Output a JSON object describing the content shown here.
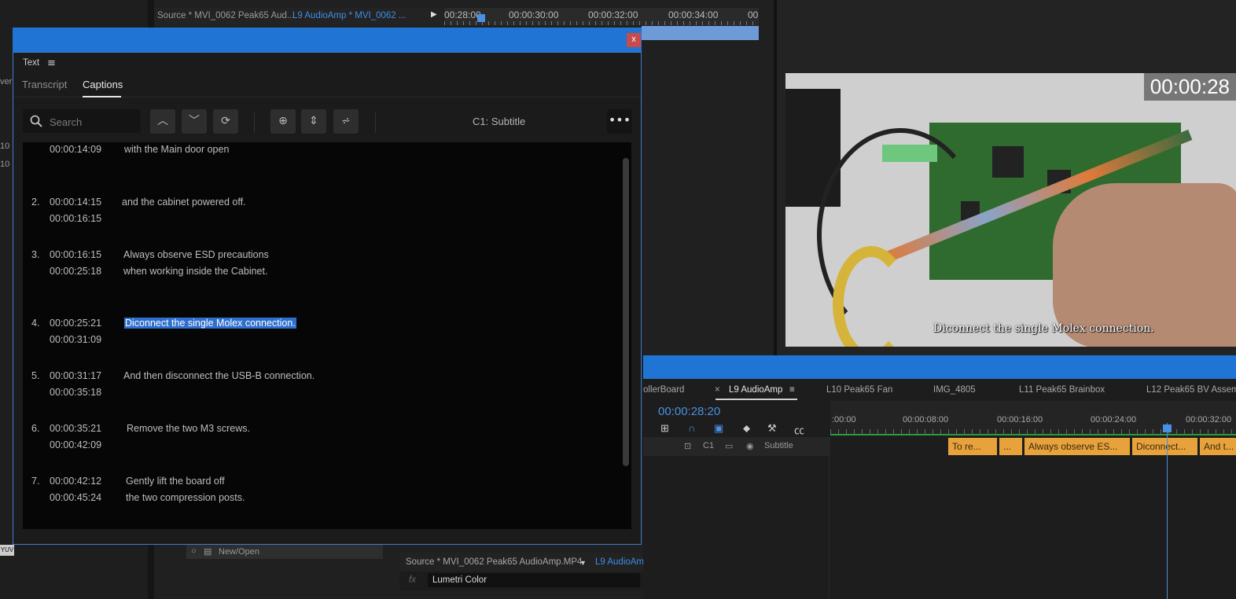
{
  "source_tabs": {
    "tab1": "Source * MVI_0062 Peak65 Aud...",
    "tab2": "L9 AudioAmp * MVI_0062 ..."
  },
  "mini_ruler": {
    "t0": "00:28:00",
    "t1": "00:00:30:00",
    "t2": "00:00:32:00",
    "t3": "00:00:34:00",
    "t4": "00"
  },
  "left_fragments": {
    "a": "ver",
    "b": "10",
    "c": "10",
    "d": "YUV"
  },
  "text_panel": {
    "close": "x",
    "panel_title": "Text",
    "menu_glyph": "≡",
    "tabs": {
      "transcript": "Transcript",
      "captions": "Captions"
    },
    "search": {
      "placeholder": "Search",
      "value": ""
    },
    "track_label": "C1: Subtitle",
    "more": "•••",
    "captions": [
      {
        "num": "",
        "in": "00:00:14:09",
        "out": "",
        "line1": "with the Main door open",
        "line2": ""
      },
      {
        "num": "2.",
        "in": "00:00:14:15",
        "out": "00:00:16:15",
        "line1": "and the cabinet powered off.",
        "line2": ""
      },
      {
        "num": "3.",
        "in": "00:00:16:15",
        "out": "00:00:25:18",
        "line1": "Always observe ESD precautions",
        "line2": "when working inside the Cabinet."
      },
      {
        "num": "4.",
        "in": "00:00:25:21",
        "out": "00:00:31:09",
        "line1": "Diconnect the single Molex connection.",
        "line2": ""
      },
      {
        "num": "5.",
        "in": "00:00:31:17",
        "out": "00:00:35:18",
        "line1": "And then disconnect the USB-B connection.",
        "line2": ""
      },
      {
        "num": "6.",
        "in": "00:00:35:21",
        "out": "00:00:42:09",
        "line1": "Remove the two M3 screws.",
        "line2": ""
      },
      {
        "num": "7.",
        "in": "00:00:42:12",
        "out": "00:00:45:24",
        "line1": "Gently lift the board off",
        "line2": "the two compression posts."
      }
    ]
  },
  "preview": {
    "timecode": "00:00:28",
    "caption": "Diconnect the single Molex connection."
  },
  "timeline": {
    "tabs": [
      "ollerBoard",
      "×",
      "L9 AudioAmp",
      "≡",
      "L10 Peak65 Fan",
      "IMG_4805",
      "L11 Peak65 Brainbox",
      "L12 Peak65 BV Assem"
    ],
    "timecode": "00:00:28:20",
    "ruler": [
      ":00:00",
      "00:00:08:00",
      "00:00:16:00",
      "00:00:24:00",
      "00:00:32:00"
    ],
    "track": {
      "lock": "🔒",
      "name": "C1",
      "label": "Subtitle"
    },
    "clips": [
      "To re...",
      "...",
      "Always observe ES...",
      "Diconnect...",
      "And t..."
    ]
  },
  "bottom": {
    "source": "Source * MVI_0062 Peak65 AudioAmp.MP4",
    "seq": "L9 AudioAm",
    "fx": "fx",
    "effect": "Lumetri Color",
    "new_open": "New/Open"
  },
  "colors": {
    "accent": "#1f74d4",
    "highlight": "#2f6fce",
    "clip": "#e8a23c",
    "close": "#c84b4b"
  }
}
